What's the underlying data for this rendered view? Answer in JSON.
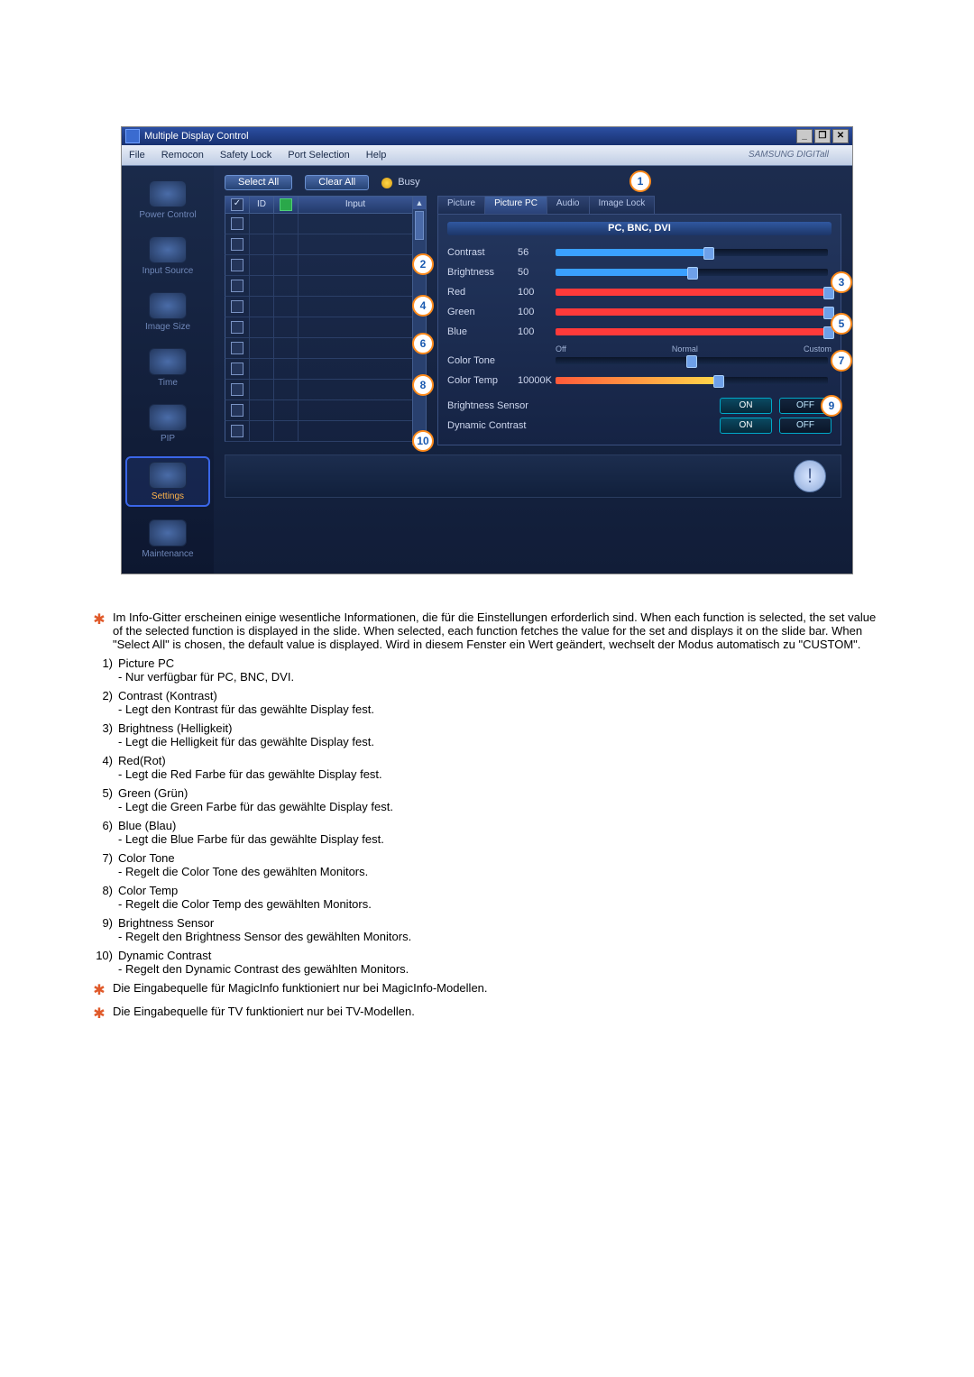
{
  "window": {
    "title": "Multiple Display Control",
    "brand": "SAMSUNG DIGITall"
  },
  "menu": [
    "File",
    "Remocon",
    "Safety Lock",
    "Port Selection",
    "Help"
  ],
  "sidebar": [
    "Power Control",
    "Input Source",
    "Image Size",
    "Time",
    "PIP",
    "Settings",
    "Maintenance"
  ],
  "toolbar": {
    "select": "Select All",
    "clear": "Clear All",
    "busy": "Busy"
  },
  "grid": {
    "h2": "ID",
    "hInput": "Input"
  },
  "tabs": [
    "Picture",
    "Picture PC",
    "Audio",
    "Image Lock"
  ],
  "panel": {
    "sub": "PC, BNC, DVI",
    "contrast": {
      "label": "Contrast",
      "val": "56",
      "pct": 56,
      "color": "#3aa0ff"
    },
    "brightness": {
      "label": "Brightness",
      "val": "50",
      "pct": 50,
      "color": "#3aa0ff"
    },
    "red": {
      "label": "Red",
      "val": "100",
      "pct": 100,
      "color": "#ff3a3a"
    },
    "green": {
      "label": "Green",
      "val": "100",
      "pct": 100,
      "color": "#ff3a3a"
    },
    "blue": {
      "label": "Blue",
      "val": "100",
      "pct": 100,
      "color": "#ff3a3a"
    },
    "colortone": {
      "label": "Color Tone",
      "off": "Off",
      "normal": "Normal",
      "custom": "Custom"
    },
    "colortemp": {
      "label": "Color Temp",
      "val": "10000K"
    },
    "bsensor": {
      "label": "Brightness Sensor",
      "on": "ON",
      "off": "OFF"
    },
    "dcontrast": {
      "label": "Dynamic Contrast",
      "on": "ON",
      "off": "OFF"
    }
  },
  "callouts": [
    "1",
    "2",
    "3",
    "4",
    "5",
    "6",
    "7",
    "8",
    "9",
    "10"
  ],
  "intro": "Im Info-Gitter erscheinen einige wesentliche Informationen, die für die Einstellungen erforderlich sind. When each function is selected, the set value of the selected function is displayed in the slide. When selected, each function fetches the value for the set and displays it on the slide bar. When \"Select All\" is chosen, the default value is displayed. Wird in diesem Fenster ein Wert geändert, wechselt der Modus automatisch zu \"CUSTOM\".",
  "items": [
    {
      "n": "1)",
      "t": "Picture PC",
      "s": "- Nur verfügbar für PC, BNC, DVI."
    },
    {
      "n": "2)",
      "t": "Contrast (Kontrast)",
      "s": "- Legt den Kontrast für das gewählte Display fest."
    },
    {
      "n": "3)",
      "t": "Brightness (Helligkeit)",
      "s": "- Legt die Helligkeit für das gewählte Display fest."
    },
    {
      "n": "4)",
      "t": "Red(Rot)",
      "s": "- Legt die Red Farbe für das gewählte Display fest."
    },
    {
      "n": "5)",
      "t": "Green (Grün)",
      "s": "- Legt die Green Farbe für das gewählte Display fest."
    },
    {
      "n": "6)",
      "t": "Blue (Blau)",
      "s": "- Legt die Blue Farbe für das gewählte Display fest."
    },
    {
      "n": "7)",
      "t": "Color Tone",
      "s": "- Regelt die Color Tone des gewählten Monitors."
    },
    {
      "n": "8)",
      "t": "Color Temp",
      "s": "- Regelt die Color Temp des gewählten Monitors."
    },
    {
      "n": "9)",
      "t": "Brightness Sensor",
      "s": "- Regelt den Brightness Sensor des gewählten Monitors."
    },
    {
      "n": "10)",
      "t": "Dynamic Contrast",
      "s": "- Regelt den Dynamic Contrast des gewählten Monitors."
    }
  ],
  "starnotes": [
    "Die Eingabequelle für MagicInfo funktioniert nur bei MagicInfo-Modellen.",
    "Die Eingabequelle für TV funktioniert nur bei TV-Modellen."
  ]
}
